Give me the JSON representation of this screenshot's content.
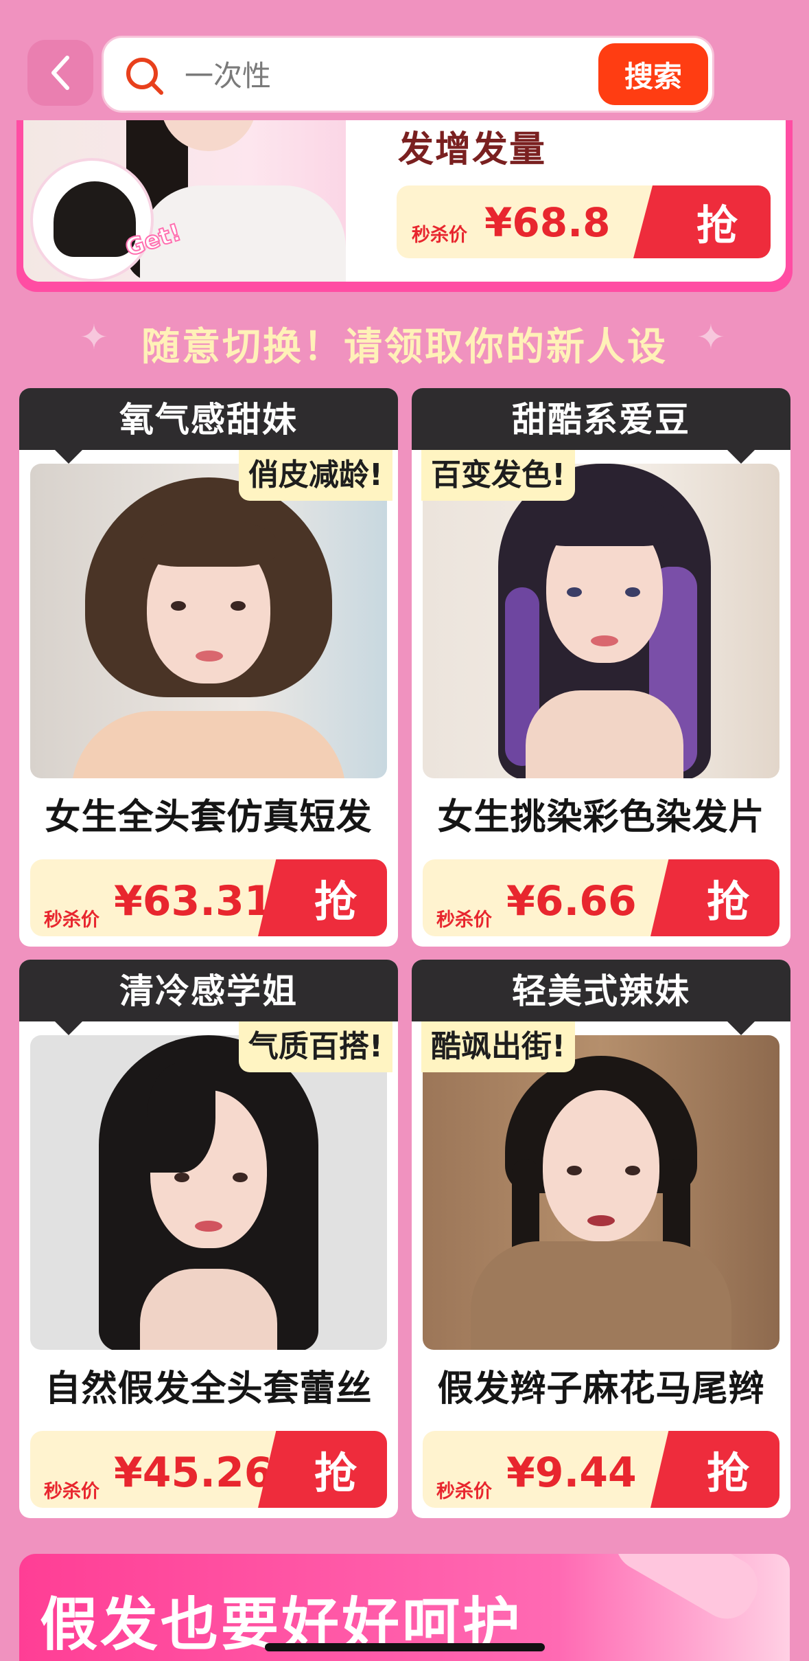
{
  "search": {
    "placeholder": "一次性",
    "button": "搜索"
  },
  "banner": {
    "title": "发增发量",
    "price_label": "秒杀价",
    "price": "¥68.8",
    "grab": "抢",
    "badge": "Get!"
  },
  "slogan": "随意切换！请领取你的新人设",
  "cards": [
    {
      "header": "氧气感甜妹",
      "tag": "俏皮减龄!",
      "name": "女生全头套仿真短发",
      "price_label": "秒杀价",
      "price": "¥63.31",
      "grab": "抢"
    },
    {
      "header": "甜酷系爱豆",
      "tag": "百变发色!",
      "name": "女生挑染彩色染发片",
      "price_label": "秒杀价",
      "price": "¥6.66",
      "grab": "抢"
    },
    {
      "header": "清冷感学姐",
      "tag": "气质百搭!",
      "name": "自然假发全头套蕾丝",
      "price_label": "秒杀价",
      "price": "¥45.26",
      "grab": "抢"
    },
    {
      "header": "轻美式辣妹",
      "tag": "酷飒出街!",
      "name": "假发辫子麻花马尾辫",
      "price_label": "秒杀价",
      "price": "¥9.44",
      "grab": "抢"
    }
  ],
  "bottom_banner": {
    "title": "假发也要好好呵护"
  },
  "colors": {
    "page_bg": "#F092BF",
    "accent_red": "#EE2C3C",
    "search_button": "#FF3D12",
    "price_bg": "#FFF3CF",
    "card_header": "#2E2C2E"
  },
  "icons": {
    "back": "chevron-left-icon",
    "search": "search-icon"
  }
}
